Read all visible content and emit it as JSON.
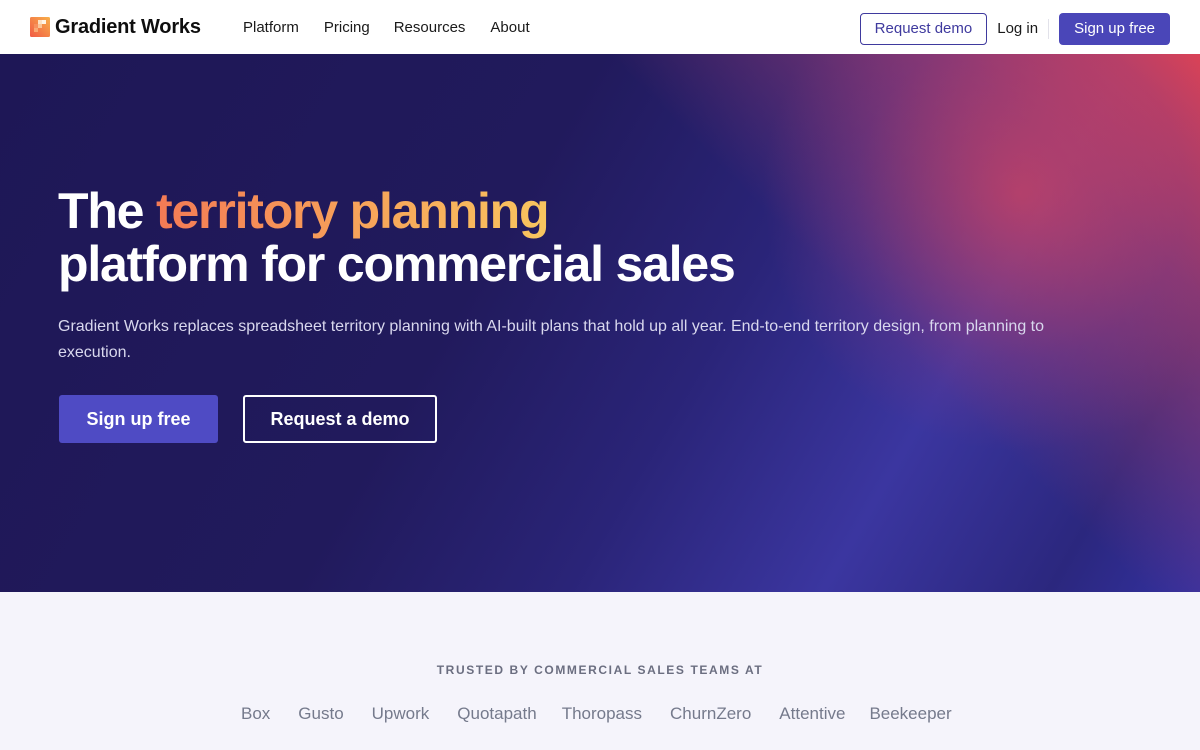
{
  "nav": {
    "brand": "Gradient Works",
    "links": [
      "Platform",
      "Pricing",
      "Resources",
      "About"
    ],
    "request_demo": "Request demo",
    "login": "Log in",
    "signup": "Sign up free"
  },
  "hero": {
    "title_prefix": "The",
    "title_highlight": "territory planning",
    "title_line2": "platform for commercial sales",
    "subtitle": "Gradient Works replaces spreadsheet territory planning with AI-built plans that hold up all year. End-to-end territory design, from planning to execution.",
    "cta_primary": "Sign up free",
    "cta_secondary": "Request a demo"
  },
  "trusted": {
    "label": "TRUSTED BY COMMERCIAL SALES TEAMS AT",
    "logos": [
      "Box",
      "Gusto",
      "Upwork",
      "Quotapath",
      "Thoropass",
      "ChurnZero",
      "Attentive",
      "Beekeeper"
    ]
  },
  "colors": {
    "brand_primary": "#4a46b8",
    "hero_bg": "#211a5c",
    "highlight_start": "#f47a55",
    "highlight_end": "#f8c55f",
    "trusted_bg": "#f5f4fb"
  },
  "icons": {
    "logo": "gradient-works-logo-mark"
  }
}
